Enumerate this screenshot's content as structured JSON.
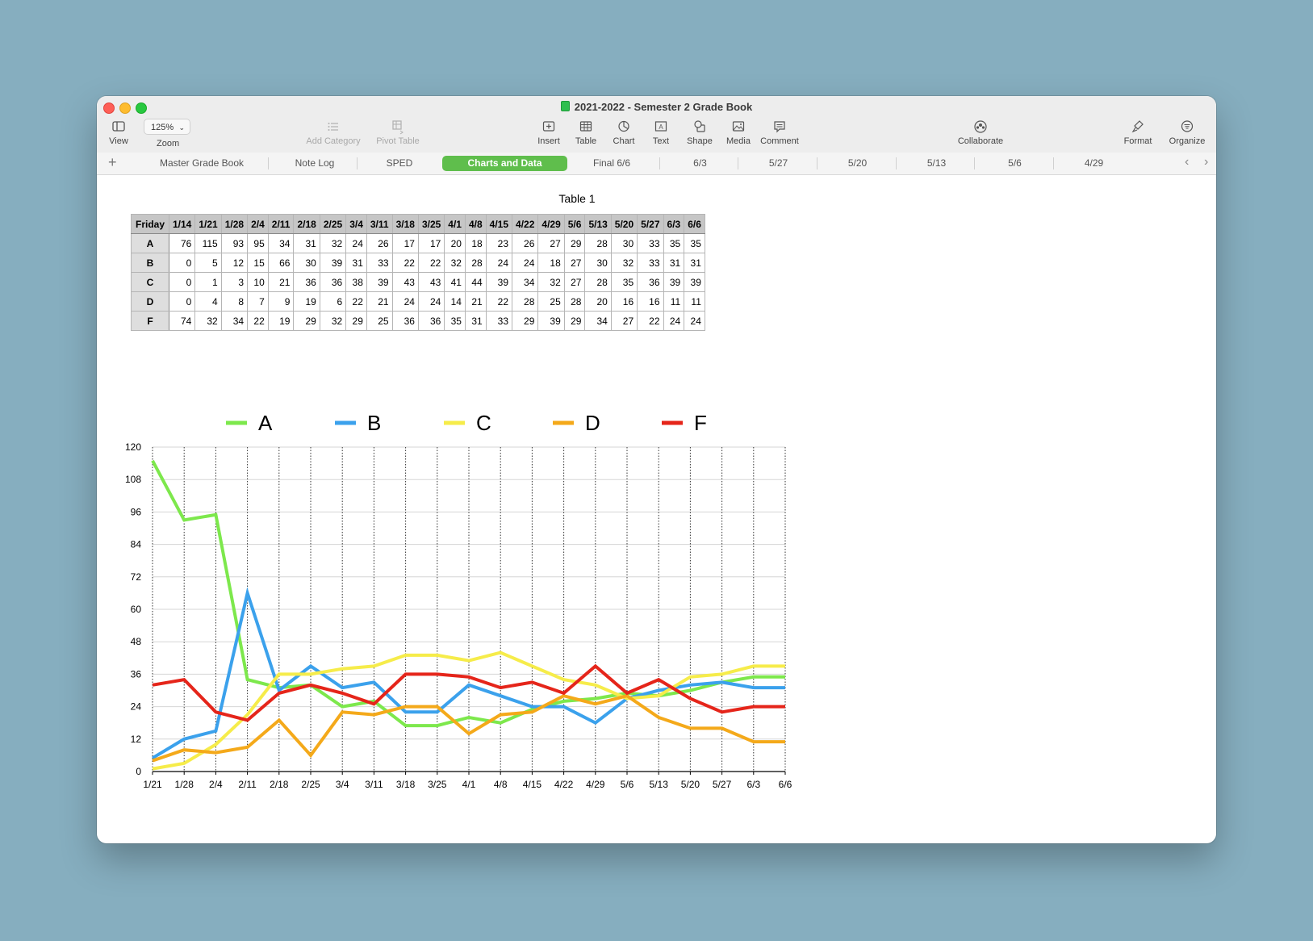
{
  "window": {
    "title": "2021-2022 - Semester 2 Grade Book"
  },
  "toolbar": {
    "view": "View",
    "zoom_value": "125%",
    "zoom": "Zoom",
    "add_category": "Add Category",
    "pivot_table": "Pivot Table",
    "insert": "Insert",
    "table": "Table",
    "chart": "Chart",
    "text": "Text",
    "shape": "Shape",
    "media": "Media",
    "comment": "Comment",
    "collaborate": "Collaborate",
    "format": "Format",
    "organize": "Organize"
  },
  "tabs": [
    "Master Grade Book",
    "Note Log",
    "SPED",
    "Charts and Data",
    "Final 6/6",
    "6/3",
    "5/27",
    "5/20",
    "5/13",
    "5/6",
    "4/29"
  ],
  "active_tab": "Charts and Data",
  "table": {
    "title": "Table 1",
    "header": [
      "Friday",
      "1/14",
      "1/21",
      "1/28",
      "2/4",
      "2/11",
      "2/18",
      "2/25",
      "3/4",
      "3/11",
      "3/18",
      "3/25",
      "4/1",
      "4/8",
      "4/15",
      "4/22",
      "4/29",
      "5/6",
      "5/13",
      "5/20",
      "5/27",
      "6/3",
      "6/6"
    ],
    "rows": [
      {
        "label": "A",
        "values": [
          76,
          115,
          93,
          95,
          34,
          31,
          32,
          24,
          26,
          17,
          17,
          20,
          18,
          23,
          26,
          27,
          29,
          28,
          30,
          33,
          35,
          35
        ]
      },
      {
        "label": "B",
        "values": [
          0,
          5,
          12,
          15,
          66,
          30,
          39,
          31,
          33,
          22,
          22,
          32,
          28,
          24,
          24,
          18,
          27,
          30,
          32,
          33,
          31,
          31
        ]
      },
      {
        "label": "C",
        "values": [
          0,
          1,
          3,
          10,
          21,
          36,
          36,
          38,
          39,
          43,
          43,
          41,
          44,
          39,
          34,
          32,
          27,
          28,
          35,
          36,
          39,
          39
        ]
      },
      {
        "label": "D",
        "values": [
          0,
          4,
          8,
          7,
          9,
          19,
          6,
          22,
          21,
          24,
          24,
          14,
          21,
          22,
          28,
          25,
          28,
          20,
          16,
          16,
          11,
          11
        ]
      },
      {
        "label": "F",
        "values": [
          74,
          32,
          34,
          22,
          19,
          29,
          32,
          29,
          25,
          36,
          36,
          35,
          31,
          33,
          29,
          39,
          29,
          34,
          27,
          22,
          24,
          24
        ]
      }
    ]
  },
  "chart_data": {
    "type": "line",
    "x": [
      "1/21",
      "1/28",
      "2/4",
      "2/11",
      "2/18",
      "2/25",
      "3/4",
      "3/11",
      "3/18",
      "3/25",
      "4/1",
      "4/8",
      "4/15",
      "4/22",
      "4/29",
      "5/6",
      "5/13",
      "5/20",
      "5/27",
      "6/3",
      "6/6"
    ],
    "ylim": [
      0,
      120
    ],
    "yticks": [
      0,
      12,
      24,
      36,
      48,
      60,
      72,
      84,
      96,
      108,
      120
    ],
    "grid": true,
    "legend": "top",
    "series": [
      {
        "name": "A",
        "color": "#7de84c",
        "values": [
          115,
          93,
          95,
          34,
          31,
          32,
          24,
          26,
          17,
          17,
          20,
          18,
          23,
          26,
          27,
          29,
          28,
          30,
          33,
          35,
          35
        ]
      },
      {
        "name": "B",
        "color": "#3ba1ec",
        "values": [
          5,
          12,
          15,
          66,
          30,
          39,
          31,
          33,
          22,
          22,
          32,
          28,
          24,
          24,
          18,
          27,
          30,
          32,
          33,
          31,
          31
        ]
      },
      {
        "name": "C",
        "color": "#f6ec4a",
        "values": [
          1,
          3,
          10,
          21,
          36,
          36,
          38,
          39,
          43,
          43,
          41,
          44,
          39,
          34,
          32,
          27,
          28,
          35,
          36,
          39,
          39
        ]
      },
      {
        "name": "D",
        "color": "#f4a91a",
        "values": [
          4,
          8,
          7,
          9,
          19,
          6,
          22,
          21,
          24,
          24,
          14,
          21,
          22,
          28,
          25,
          28,
          20,
          16,
          16,
          11,
          11
        ]
      },
      {
        "name": "F",
        "color": "#e5251a",
        "values": [
          32,
          34,
          22,
          19,
          29,
          32,
          29,
          25,
          36,
          36,
          35,
          31,
          33,
          29,
          39,
          29,
          34,
          27,
          22,
          24,
          24
        ]
      }
    ]
  }
}
